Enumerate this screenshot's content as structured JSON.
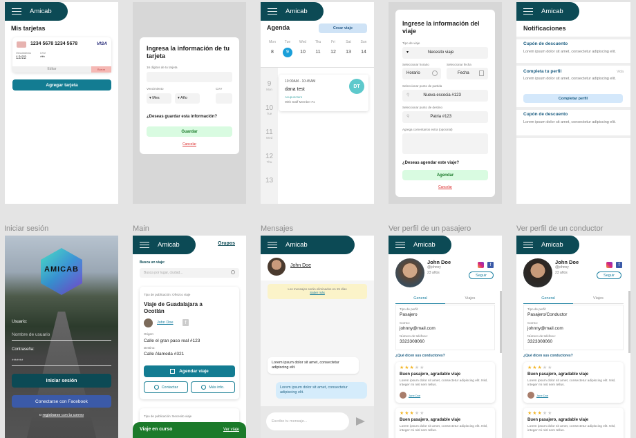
{
  "app_name": "Amicab",
  "labels": {
    "login": "Iniciar sesión",
    "main": "Main",
    "messages": "Mensajes",
    "passenger": "Ver perfil de un pasajero",
    "driver": "Ver perfil de un conductor"
  },
  "cards": {
    "title": "Mis tarjetas",
    "number": "1234 5678 1234 5678",
    "brand": "VISA",
    "exp_label": "Vencimiento",
    "exp": "12/22",
    "cvv_label": "CVV",
    "cvv": "***",
    "edit": "Editar",
    "delete": "Borrar",
    "add": "Agregar tarjeta"
  },
  "cardform": {
    "title": "Ingresa la información de tu tarjeta",
    "digits": "16 dígitos de tu tarjeta",
    "exp": "Vencimiento",
    "cvv": "CVV",
    "month": "Mes",
    "year": "Año",
    "question": "¿Deseas guardar esta información?",
    "save": "Guardar",
    "cancel": "Cancelar"
  },
  "agenda": {
    "title": "Agenda",
    "create": "Crear viaje",
    "days": [
      "Mon",
      "Tue",
      "Wed",
      "Thu",
      "Fri",
      "Sat",
      "Sun"
    ],
    "dates": [
      "8",
      "9",
      "10",
      "11",
      "12",
      "13",
      "14"
    ],
    "times": [
      {
        "n": "9",
        "d": "Mon"
      },
      {
        "n": "10",
        "d": "Tue"
      },
      {
        "n": "11",
        "d": "Wed"
      },
      {
        "n": "12",
        "d": "Thu"
      },
      {
        "n": "13",
        "d": ""
      }
    ],
    "event_time": "10:00AM - 10:45AM",
    "event_title": "dana test",
    "event_sub1": "Acupuncture",
    "event_sub2": "With Staff Member #1",
    "avatar": "DT"
  },
  "tripform": {
    "title": "Ingrese la información del viaje",
    "type_label": "Tipo de viaje",
    "type": "Necesito viaje",
    "time_label": "Seleccionar horario",
    "date_label": "Seleccionar fecha",
    "time": "Horario",
    "date": "Fecha",
    "from_label": "Seleccionar punto de partida",
    "from": "Nueva escocia #123",
    "to_label": "Seleccionar punto de destino",
    "to": "Patria #123",
    "comments": "Agrega comentarios extra (opcional)",
    "question": "¿Deseas agendar este viaje?",
    "schedule": "Agendar",
    "cancel": "Cancelar"
  },
  "notifications": {
    "title": "Notificaciones",
    "items": [
      {
        "title": "Cupón de descuento",
        "text": "Lorem ipsum dolor sit amet, consectetur adipiscing elit."
      },
      {
        "title": "Completa tu perfil",
        "text": "Lorem ipsum dolor sit amet, consectetur adipiscing elit.",
        "tag": "Vida",
        "button": "Completar perfil"
      },
      {
        "title": "Cupón de descuento",
        "text": "Lorem ipsum dolor sit amet, consectetur adipiscing elit."
      }
    ]
  },
  "login": {
    "logo": "AMICAB",
    "user_label": "Usuario:",
    "user_ph": "Nombre de usuario",
    "pass_label": "Contraseña:",
    "pass": "*******",
    "signin": "Iniciar sesión",
    "facebook": "Conectarse con Facebook",
    "or": "o",
    "register": "registrarse con tu correo"
  },
  "main": {
    "groups": "Grupos",
    "search_label": "Busca un viaje:",
    "search_ph": "Busca por lugar, ciudad...",
    "pub_label": "Tipo de publicación: Ofrezco viaje",
    "trip_title": "Viaje de Guadalajara a Ocotlán",
    "user": "John Doe",
    "origin_label": "Origen:",
    "origin": "Calle el gran paso real #123",
    "dest_label": "Destino:",
    "dest": "Calle Alameda #321",
    "schedule": "Agendar viaje",
    "contact": "Contactar",
    "more": "Más info.",
    "pub2": "Tipo de publicación: Necesito viaje",
    "current": "Viaje en curso",
    "view": "Ver viaje"
  },
  "messages": {
    "contact": "John Doe",
    "notice": "Los mensajes serán eliminados en 15 días",
    "learn": "Saber más",
    "m1": "Lorem ipsum dolor sit amet, consectetur adipiscing elit.",
    "m2": "Lorem ipsum dolor sit amet, consectetur adipiscing elit.",
    "input_ph": "Escribe tu mensaje..."
  },
  "passenger": {
    "name": "John Doe",
    "handle": "@johnny",
    "age": "23 años",
    "follow": "Seguir",
    "tab1": "General",
    "tab2": "Viajes",
    "type_label": "Tipo de perfil:",
    "type": "Pasajero",
    "email_label": "Correo:",
    "email": "johnny@mail.com",
    "phone_label": "Número de teléfono:",
    "phone": "3323308060",
    "reviews_title": "¿Qué dicen sus conductores?",
    "r_title": "Buen pasajero, agradable viaje",
    "r_text": "Lorem ipsum dolor sit amet, consectetur adipiscing elit. Nisl, integer mi nisl sem tellus.",
    "r_user": "Jane Doe"
  },
  "driver": {
    "name": "John Doe",
    "handle": "@johnny",
    "age": "23 años",
    "follow": "Seguir",
    "tab1": "General",
    "tab2": "Viajes",
    "type_label": "Tipo de perfil:",
    "type": "Pasajero/Conductor",
    "email_label": "Correo:",
    "email": "johnny@mail.com",
    "phone_label": "Número de teléfono:",
    "phone": "3323308060",
    "reviews_title": "¿Qué dicen sus conductores?",
    "r_title": "Buen pasajero, agradable viaje",
    "r_text": "Lorem ipsum dolor sit amet, consectetur adipiscing elit. Nisl, integer mi nisl sem tellus.",
    "r_user": "Jane Doe"
  },
  "colors": {
    "primary": "#0c4a55",
    "accent": "#1a8fa8",
    "green": "#1b7a2a",
    "mint": "#d9fbe1"
  }
}
